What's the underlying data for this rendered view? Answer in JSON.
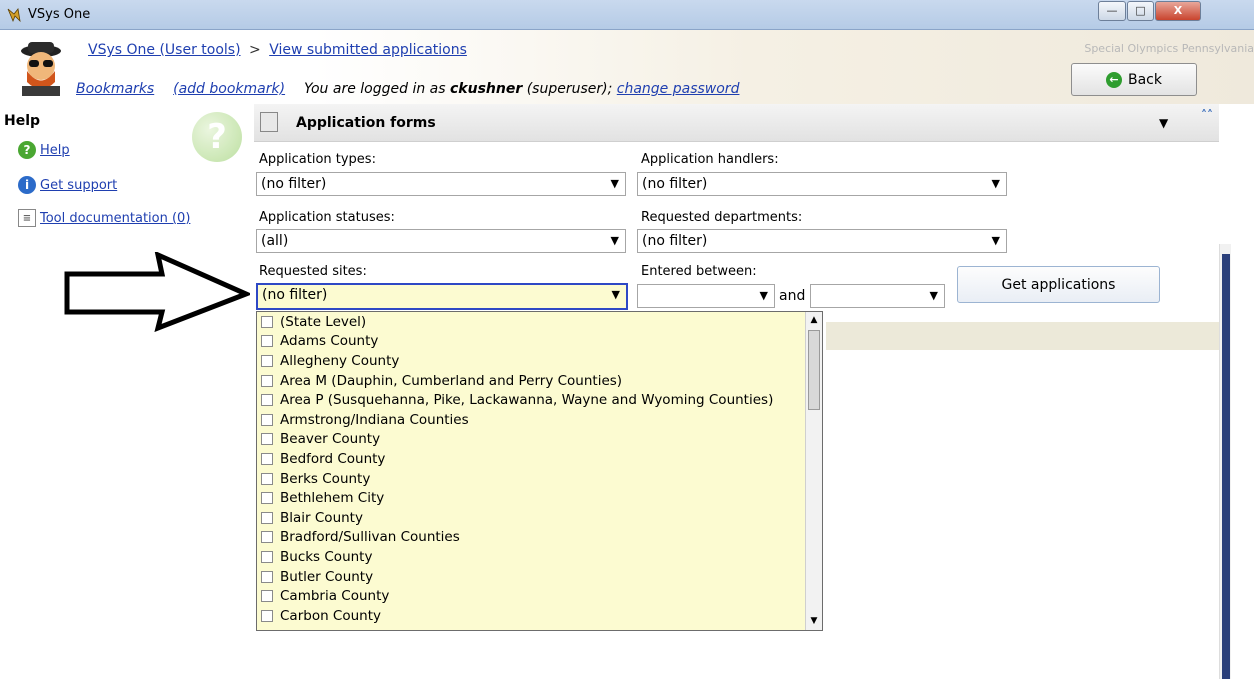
{
  "window": {
    "title": "VSys One",
    "controls": [
      "minimize",
      "maximize",
      "close"
    ]
  },
  "header": {
    "crumb_root": "VSys One (User tools)",
    "crumb_sep": ">",
    "crumb_current": "View submitted applications",
    "bookmarks": "Bookmarks",
    "add_bookmark": "(add bookmark)",
    "logged_prefix": "You are logged in as",
    "user": "ckushner",
    "role": "(superuser);",
    "change_password": "change password",
    "org": "Special Olympics Pennsylvania",
    "back_label": "Back"
  },
  "help": {
    "title": "Help",
    "items": [
      {
        "label": "Help",
        "icon": "help-icon"
      },
      {
        "label": "Get support",
        "icon": "info-icon"
      },
      {
        "label": "Tool documentation (0)",
        "icon": "document-icon"
      }
    ]
  },
  "panel": {
    "title": "Application forms",
    "application_types": {
      "label": "Application types:",
      "value": "(no filter)"
    },
    "application_handlers": {
      "label": "Application handlers:",
      "value": "(no filter)"
    },
    "application_statuses": {
      "label": "Application statuses:",
      "value": "(all)"
    },
    "requested_departments": {
      "label": "Requested departments:",
      "value": "(no filter)"
    },
    "requested_sites": {
      "label": "Requested sites:",
      "value": "(no filter)"
    },
    "entered_between": {
      "label": "Entered between:",
      "from": "",
      "and_label": "and",
      "to": ""
    },
    "get_applications": "Get applications"
  },
  "sites_list": [
    "(State Level)",
    "Adams County",
    "Allegheny County",
    "Area M (Dauphin, Cumberland and Perry Counties)",
    "Area P (Susquehanna, Pike, Lackawanna, Wayne and Wyoming Counties)",
    "Armstrong/Indiana Counties",
    "Beaver County",
    "Bedford County",
    "Berks County",
    "Bethlehem City",
    "Blair County",
    "Bradford/Sullivan Counties",
    "Bucks County",
    "Butler County",
    "Cambria County",
    "Carbon County"
  ],
  "colors": {
    "link": "#1f3fb0",
    "dropdown_bg": "#fcfbd1",
    "focus_border": "#2e48c5"
  }
}
